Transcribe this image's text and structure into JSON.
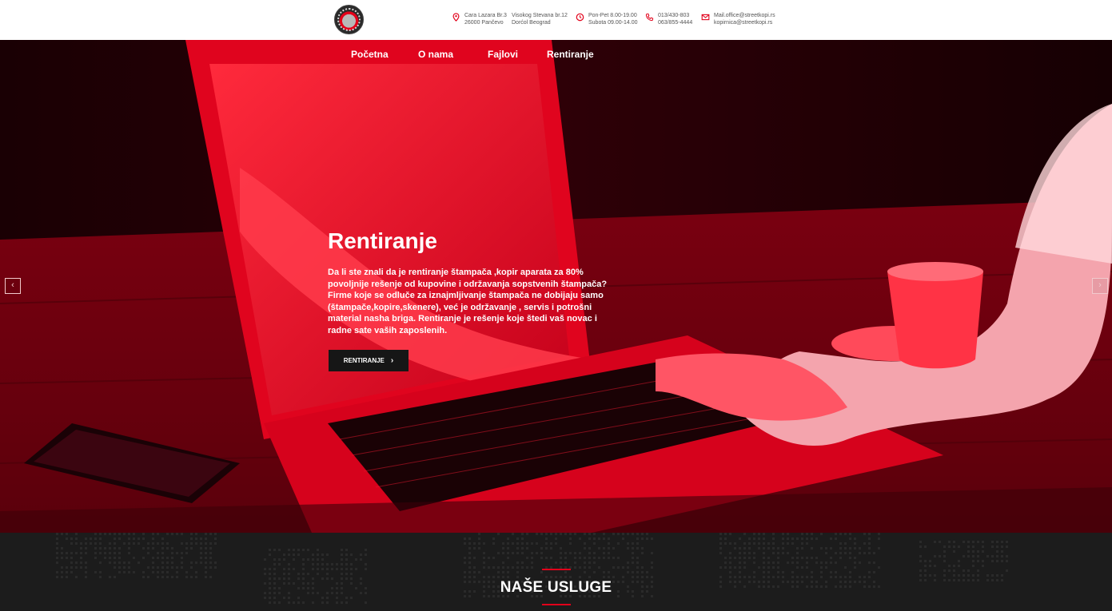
{
  "header": {
    "logo_icon": "streetkopi-logo-icon",
    "address1": [
      "Cara Lazara Br.3",
      "26000 Pančevo"
    ],
    "address2": [
      "Visokog Stevana br.12",
      "Dorćol Beograd"
    ],
    "hours": [
      "Pon-Pet 8.00-19.00",
      "Subota 09.00-14.00"
    ],
    "phones": [
      "013/430-803",
      "063/855-4444"
    ],
    "emails": [
      "Mail.office@streetkopi.rs",
      "kopirnica@streetkopi.rs"
    ],
    "icon_color": "#e2001a"
  },
  "nav": {
    "items": [
      "Početna",
      "O nama",
      "Fajlovi",
      "Rentiranje"
    ]
  },
  "slider": {
    "title": "Rentiranje",
    "text": "Da li ste znali da je rentiranje štampača ,kopir aparata za 80% povoljnije rešenje od kupovine i održavanja sopstvenih štampača? Firme koje se odluče za iznajmljivanje štampača ne dobijaju samo (štampače,kopire,skenere), već je održavanje , servis i potrošni material nasha briga. Rentiranje je rešenje koje štedi vaš novac i radne sate vaših zaposlenih.",
    "button": "RENTIRANJE",
    "prev": "‹",
    "next": "›",
    "overlay_color": "#e2001a"
  },
  "services": {
    "title": "NAŠE USLUGE"
  }
}
